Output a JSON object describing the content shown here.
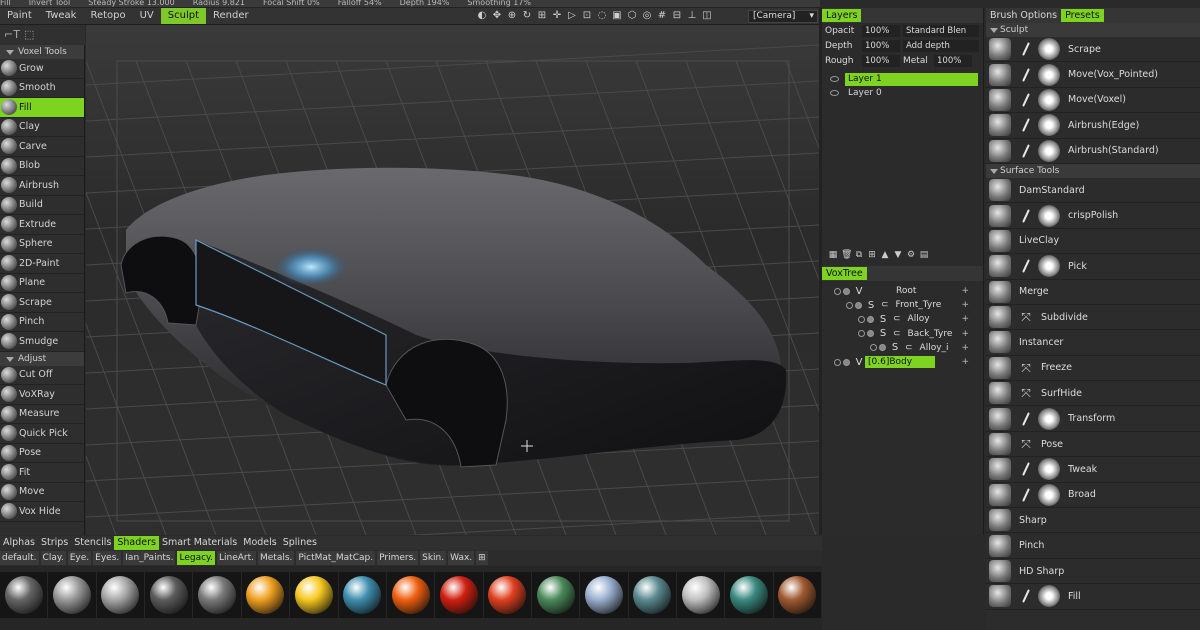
{
  "topbar": {
    "items": [
      "Fill",
      "Invert Tool",
      "Steady Stroke 13.000",
      "Radius 9.821",
      "Focal Shift 0%",
      "Falloff 54%",
      "Depth 194%",
      "Smoothing 17%"
    ]
  },
  "menu": {
    "rooms": [
      "Paint",
      "Tweak",
      "Retopo",
      "UV",
      "Sculpt",
      "Render"
    ],
    "active": "Sculpt",
    "camera": "[Camera]"
  },
  "left_panel": {
    "section1": "Voxel Tools",
    "tools1": [
      "Grow",
      "Smooth",
      "Fill",
      "Clay",
      "Carve",
      "Blob",
      "Airbrush",
      "Build",
      "Extrude",
      "Sphere",
      "2D-Paint",
      "Plane",
      "Scrape",
      "Pinch",
      "Smudge"
    ],
    "active_tool": "Fill",
    "section2": "Adjust",
    "tools2": [
      "Cut Off",
      "VoXRay",
      "Measure",
      "Quick Pick",
      "Pose",
      "Fit",
      "Move",
      "Vox Hide"
    ]
  },
  "layers_panel": {
    "tab": "Layers",
    "opacity_label": "Opacit",
    "opacity_value": "100%",
    "blend_mode": "Standard Blen",
    "depth_label": "Depth",
    "depth_value": "100%",
    "depth_mode": "Add depth",
    "rough_label": "Rough",
    "rough_value": "100%",
    "metal_label": "Metal",
    "metal_value": "100%",
    "layers": [
      "Layer 1",
      "Layer 0"
    ],
    "active_layer": "Layer 1"
  },
  "voxtree": {
    "tab": "VoxTree",
    "nodes": [
      {
        "type": "V",
        "name": "Root"
      },
      {
        "type": "S",
        "name": "Front_Tyre"
      },
      {
        "type": "S",
        "name": "Alloy"
      },
      {
        "type": "S",
        "name": "Back_Tyre"
      },
      {
        "type": "S",
        "name": "Alloy_i"
      },
      {
        "type": "V",
        "name": "[0.6]Body"
      }
    ],
    "active_node": "[0.6]Body"
  },
  "brush_panel": {
    "tabs": [
      "Brush Options",
      "Presets"
    ],
    "active_tab": "Presets",
    "sculpt_header": "Sculpt",
    "sculpt_items": [
      "Scrape",
      "Move(Vox_Pointed)",
      "Move(Voxel)",
      "Airbrush(Edge)",
      "Airbrush(Standard)"
    ],
    "surface_header": "Surface Tools",
    "surface_items": [
      "DamStandard",
      "crispPolish",
      "LiveClay",
      "Pick",
      "Merge",
      "Subdivide",
      "Instancer",
      "Freeze",
      "SurfHide",
      "Transform",
      "Pose",
      "Tweak",
      "Broad",
      "Sharp",
      "Pinch",
      "HD Sharp",
      "Fill"
    ]
  },
  "bottom_panel": {
    "tabs": [
      "Alphas",
      "Strips",
      "Stencils",
      "Shaders",
      "Smart Materials",
      "Models",
      "Splines"
    ],
    "active_tab": "Shaders",
    "categories": [
      "default.",
      "Clay.",
      "Eye.",
      "Eyes.",
      "Ian_Paints.",
      "Legacy.",
      "LineArt.",
      "Metals.",
      "PictMat_MatCap.",
      "Primers.",
      "Skin.",
      "Wax."
    ],
    "active_category": "Legacy.",
    "shader_colors": [
      "#666666",
      "#9a9a9a",
      "#a8a8a8",
      "#5c5c5c",
      "#7a7a7a",
      "#f0a020",
      "#f7c820",
      "#3f8fb0",
      "#f06010",
      "#d02010",
      "#e04020",
      "#4a8a5a",
      "#9ab0d0",
      "#5a8a90",
      "#c0c0c0",
      "#3a8a80",
      "#a05a30"
    ]
  }
}
